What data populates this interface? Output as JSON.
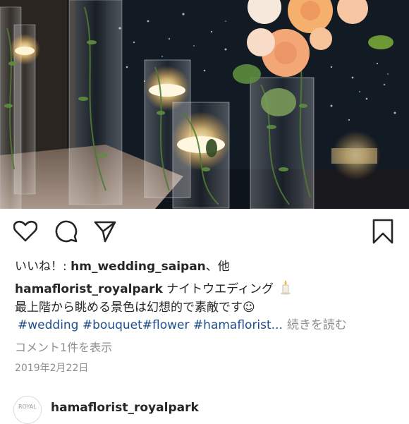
{
  "post": {
    "image": {
      "alt": "Glass cylinder vases with floating candles, greenery and peach roses in front of a night city view"
    },
    "actions": {
      "like_icon": "heart-outline-icon",
      "comment_icon": "comment-bubble-icon",
      "share_icon": "paper-plane-icon",
      "save_icon": "bookmark-outline-icon"
    },
    "likes": {
      "prefix": "いいね！: ",
      "user": "hm_wedding_saipan",
      "suffix": "、他"
    },
    "caption": {
      "author": "hamaflorist_royalpark",
      "text_line1": " ナイトウエディング",
      "emoji_icon": "candle-icon",
      "text_line2": "最上階から眺める景色は幻想的で素敵です☺",
      "hashtags": [
        "#wedding",
        "#bouquet",
        "#flower",
        "#hamaflorist..."
      ],
      "more_label": "続きを読む"
    },
    "comments_link": "コメント1件を表示",
    "date": "2019年2月22日"
  },
  "next_post": {
    "username": "hamaflorist_royalpark",
    "avatar_text": "ROYAL"
  },
  "colors": {
    "text": "#262626",
    "secondary": "#8e8e8e",
    "hashtag": "#1d4f8c"
  }
}
